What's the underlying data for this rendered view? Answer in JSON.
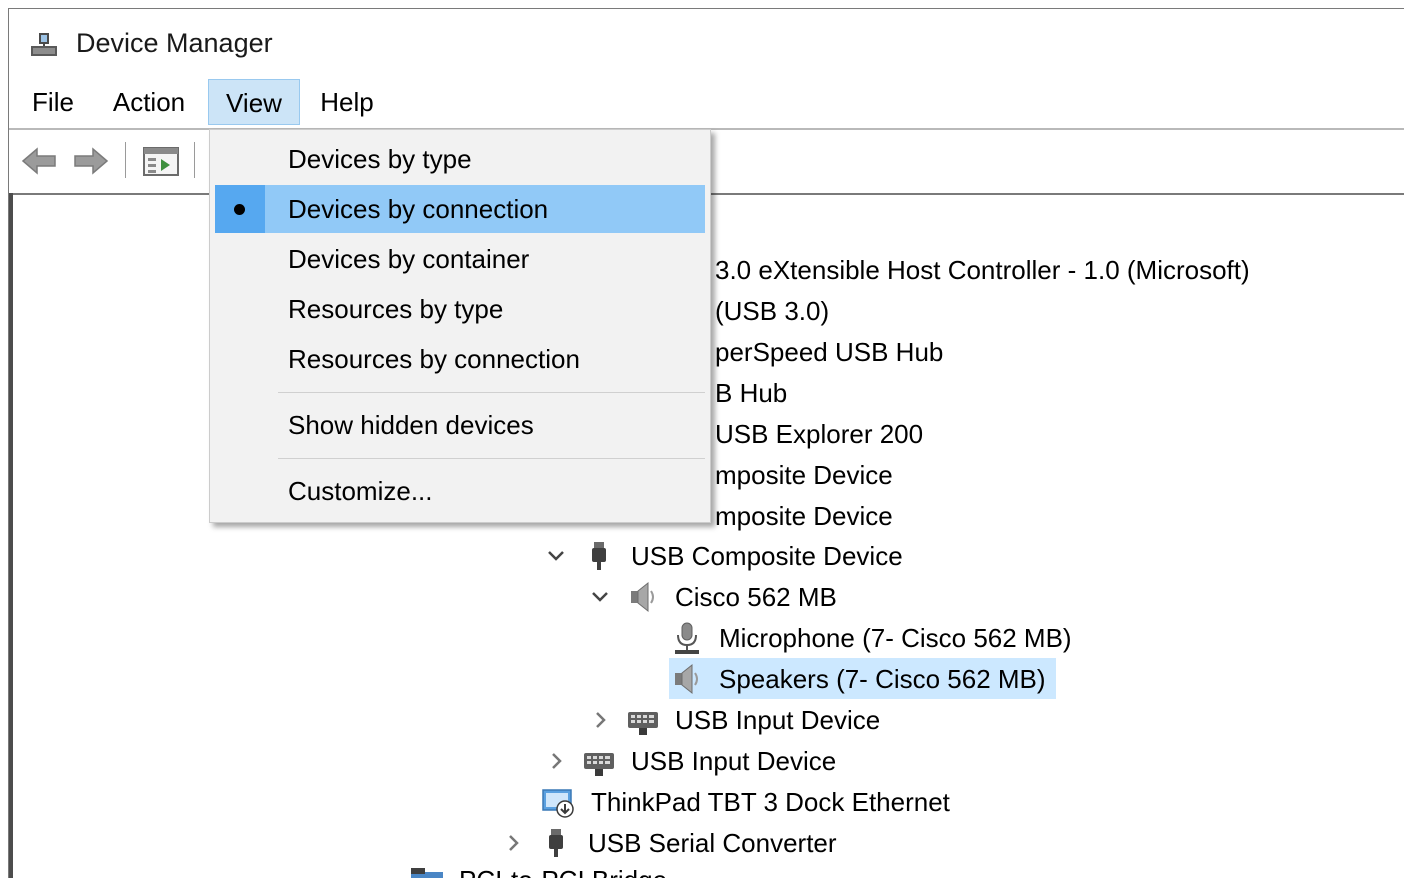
{
  "window": {
    "title": "Device Manager",
    "app_icon": "device-manager-icon"
  },
  "menubar": {
    "items": [
      {
        "label": "File"
      },
      {
        "label": "Action"
      },
      {
        "label": "View"
      },
      {
        "label": "Help"
      }
    ],
    "active": "View"
  },
  "toolbar": {
    "buttons": [
      "back-arrow-icon",
      "forward-arrow-icon",
      "properties-pane-icon"
    ]
  },
  "view_menu": {
    "items": [
      {
        "label": "Devices by type",
        "checked": false
      },
      {
        "label": "Devices by connection",
        "checked": true
      },
      {
        "label": "Devices by container",
        "checked": false
      },
      {
        "label": "Resources by type",
        "checked": false
      },
      {
        "label": "Resources by connection",
        "checked": false
      },
      {
        "label": "Show hidden devices",
        "checked": false
      },
      {
        "label": "Customize...",
        "checked": false
      }
    ]
  },
  "tree": {
    "partial_rows": [
      {
        "label": "3.0 eXtensible Host Controller - 1.0 (Microsoft)"
      },
      {
        "label": "(USB 3.0)"
      },
      {
        "label": "perSpeed USB Hub"
      },
      {
        "label": "B Hub"
      },
      {
        "label": "USB Explorer 200"
      },
      {
        "label": "mposite Device"
      },
      {
        "label": "mposite Device"
      }
    ],
    "rows": [
      {
        "label": "USB Composite Device",
        "icon": "usb-plug-icon",
        "expander": "expanded"
      },
      {
        "label": "Cisco 562 MB",
        "icon": "speaker-icon",
        "expander": "expanded"
      },
      {
        "label": "Microphone (7- Cisco 562 MB)",
        "icon": "microphone-icon",
        "expander": "none"
      },
      {
        "label": "Speakers (7- Cisco 562 MB)",
        "icon": "speaker-icon",
        "expander": "none",
        "selected": true
      },
      {
        "label": "USB Input Device",
        "icon": "keyboard-icon",
        "expander": "collapsed"
      },
      {
        "label": "USB Input Device",
        "icon": "keyboard-icon",
        "expander": "collapsed"
      },
      {
        "label": "ThinkPad TBT 3 Dock Ethernet",
        "icon": "network-adapter-icon",
        "expander": "none"
      },
      {
        "label": "USB Serial Converter",
        "icon": "usb-plug-icon",
        "expander": "collapsed"
      },
      {
        "label": "PCI-to-PCI Bridge",
        "icon": "system-device-icon",
        "expander": "none"
      }
    ]
  },
  "colors": {
    "menu_active_bg": "#cce4f7",
    "dropdown_highlight": "#91c9f7",
    "dropdown_check_col": "#56a8f0",
    "tree_selected_bg": "#cce8ff"
  }
}
